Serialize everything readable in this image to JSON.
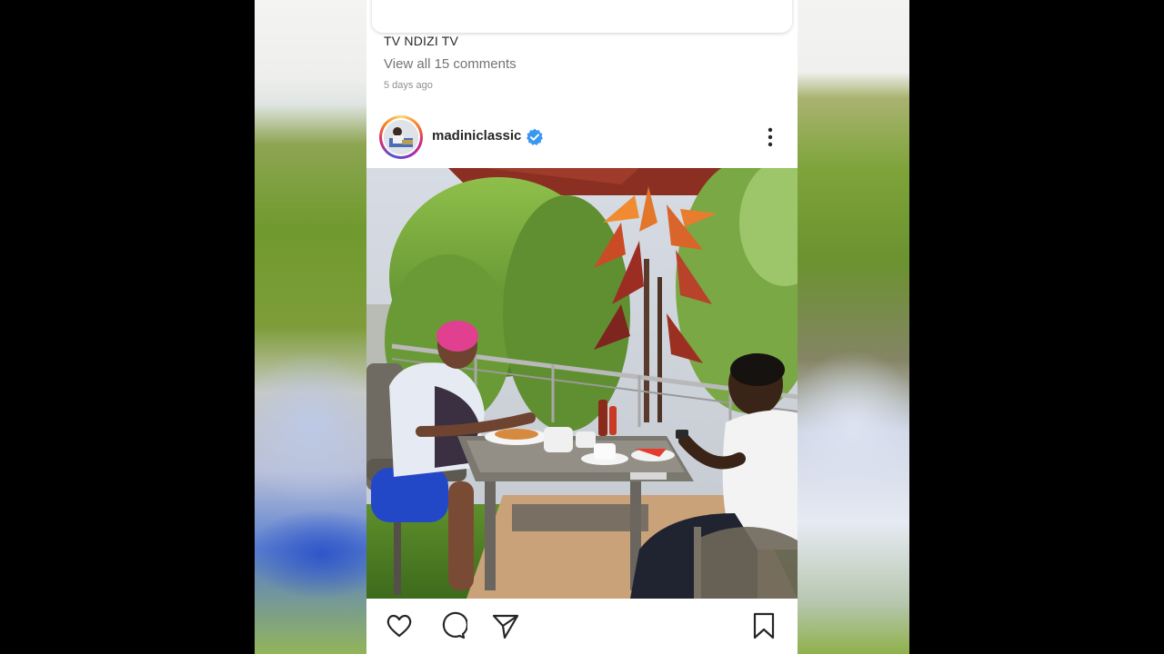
{
  "previous_post": {
    "caption": "TV NDIZI TV",
    "comments_link": "View all 15 comments",
    "time_ago": "5 days ago"
  },
  "post": {
    "username": "madiniclassic",
    "verified": true,
    "verified_icon": "verified-badge-icon",
    "more_icon": "more-options-icon"
  },
  "actions": {
    "like_icon": "heart-icon",
    "comment_icon": "comment-icon",
    "share_icon": "send-icon",
    "save_icon": "bookmark-icon"
  },
  "colors": {
    "verified_blue": "#3897f0",
    "text_primary": "#262626",
    "text_secondary": "#737373",
    "backdrop": "#000000"
  }
}
